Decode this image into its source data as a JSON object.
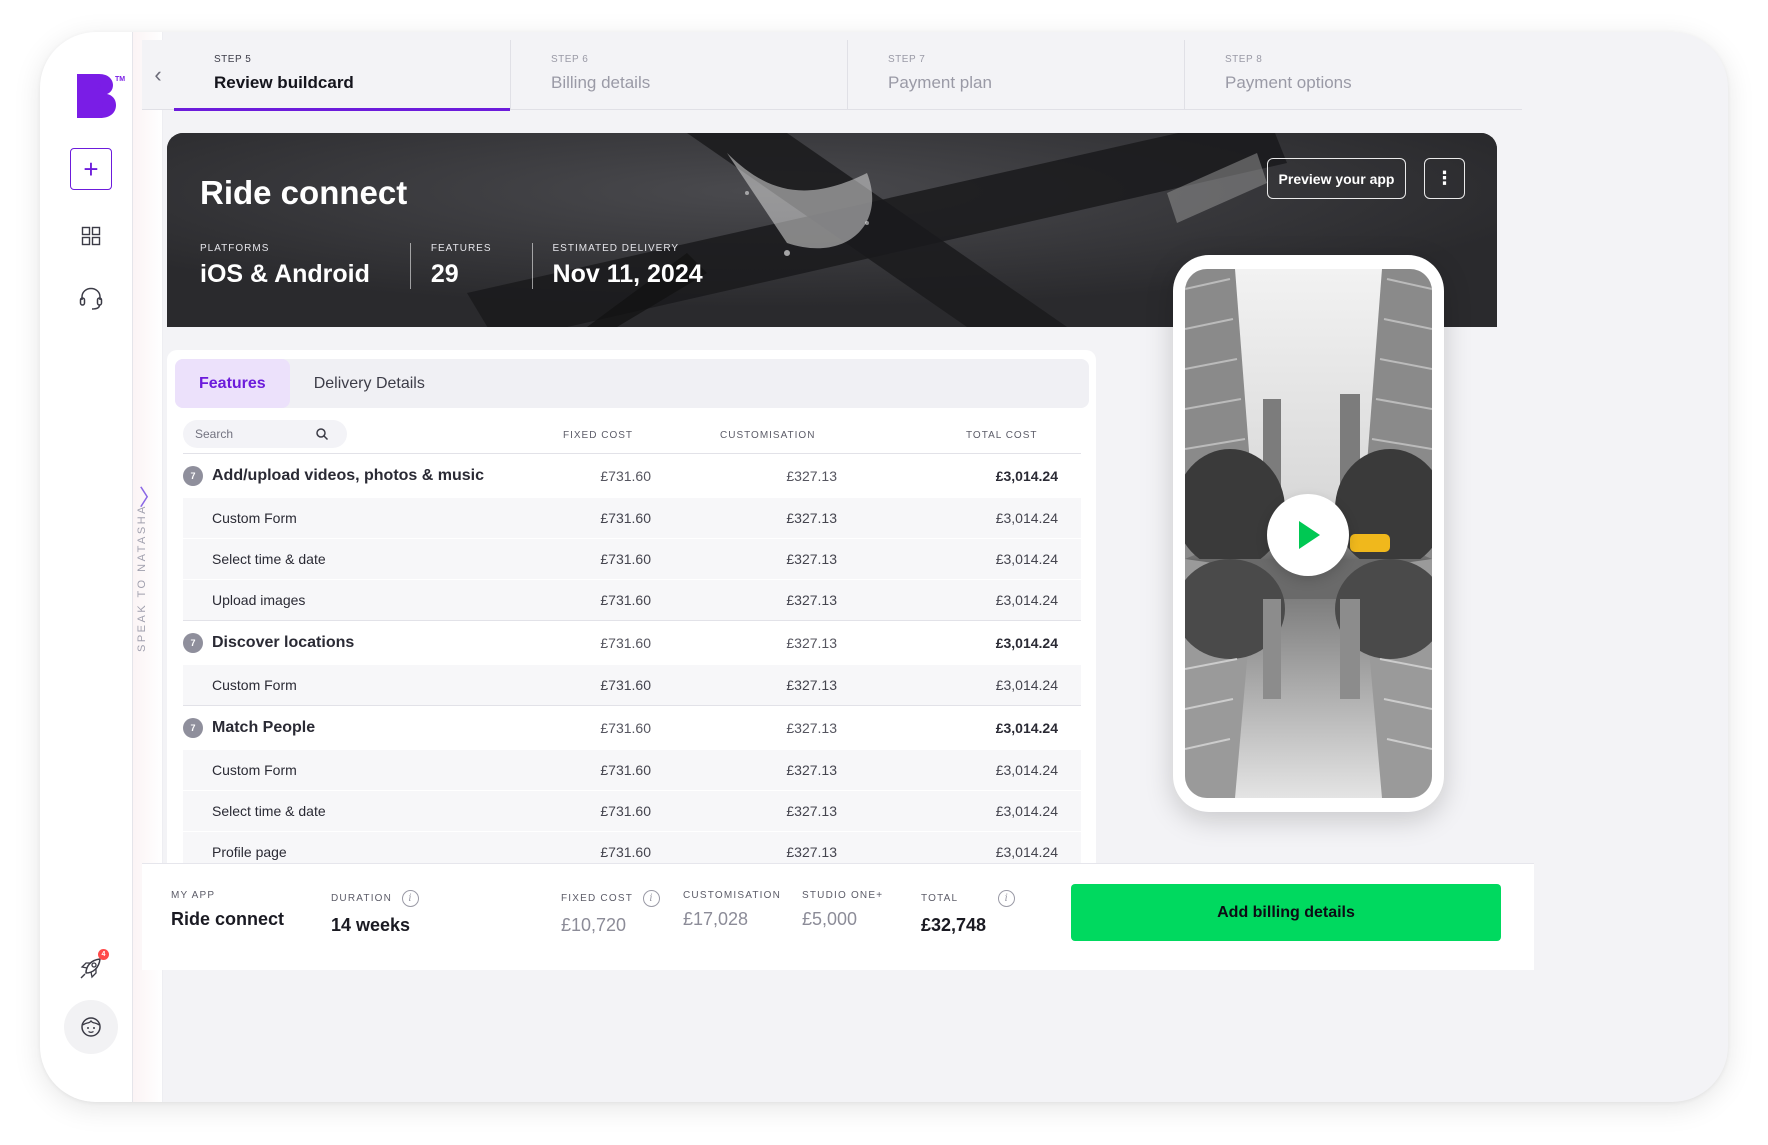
{
  "sidebar": {
    "rocket_badge": "4",
    "icons": [
      "logo-b",
      "plus-icon",
      "dashboard-grid-icon",
      "headset-icon",
      "rocket-icon",
      "avatar-icon"
    ]
  },
  "natasha": {
    "label": "SPEAK TO NATASHA"
  },
  "steps": [
    {
      "num": "STEP 5",
      "title": "Review buildcard",
      "active": true
    },
    {
      "num": "STEP 6",
      "title": "Billing details",
      "active": false
    },
    {
      "num": "STEP 7",
      "title": "Payment plan",
      "active": false
    },
    {
      "num": "STEP 8",
      "title": "Payment options",
      "active": false
    }
  ],
  "hero": {
    "title": "Ride connect",
    "platforms_label": "PLATFORMS",
    "platforms_value": "iOS & Android",
    "features_label": "FEATURES",
    "features_value": "29",
    "delivery_label": "ESTIMATED DELIVERY",
    "delivery_value": "Nov 11, 2024",
    "preview_button": "Preview your app",
    "more_button": "⋮"
  },
  "tabs": {
    "features": "Features",
    "delivery": "Delivery Details"
  },
  "table": {
    "search_placeholder": "Search",
    "headers": {
      "fixed": "FIXED COST",
      "custom": "CUSTOMISATION",
      "total": "TOTAL COST"
    },
    "rows": [
      {
        "type": "group",
        "count": "7",
        "name": "Add/upload videos, photos & music",
        "fixed": "£731.60",
        "cust": "£327.13",
        "total": "£3,014.24"
      },
      {
        "type": "sub",
        "name": "Custom Form",
        "fixed": "£731.60",
        "cust": "£327.13",
        "total": "£3,014.24"
      },
      {
        "type": "sub",
        "name": "Select time & date",
        "fixed": "£731.60",
        "cust": "£327.13",
        "total": "£3,014.24"
      },
      {
        "type": "sub",
        "name": "Upload images",
        "fixed": "£731.60",
        "cust": "£327.13",
        "total": "£3,014.24"
      },
      {
        "type": "group",
        "count": "7",
        "name": "Discover locations",
        "fixed": "£731.60",
        "cust": "£327.13",
        "total": "£3,014.24"
      },
      {
        "type": "sub",
        "name": "Custom Form",
        "fixed": "£731.60",
        "cust": "£327.13",
        "total": "£3,014.24"
      },
      {
        "type": "group",
        "count": "7",
        "name": "Match People",
        "fixed": "£731.60",
        "cust": "£327.13",
        "total": "£3,014.24"
      },
      {
        "type": "sub",
        "name": "Custom Form",
        "fixed": "£731.60",
        "cust": "£327.13",
        "total": "£3,014.24"
      },
      {
        "type": "sub",
        "name": "Select time & date",
        "fixed": "£731.60",
        "cust": "£327.13",
        "total": "£3,014.24"
      },
      {
        "type": "sub",
        "name": "Profile page",
        "fixed": "£731.60",
        "cust": "£327.13",
        "total": "£3,014.24"
      }
    ]
  },
  "footer": {
    "myapp_label": "MY APP",
    "myapp_value": "Ride connect",
    "duration_label": "DURATION",
    "duration_value": "14 weeks",
    "fixed_label": "FIXED COST",
    "fixed_value": "£10,720",
    "custom_label": "CUSTOMISATION",
    "custom_value": "£17,028",
    "studio_label": "STUDIO ONE+",
    "studio_value": "£5,000",
    "total_label": "TOTAL",
    "total_value": "£32,748",
    "billing_button": "Add billing details"
  },
  "colors": {
    "accent": "#6c1bdb",
    "cta": "#00d95f",
    "hero_bg": "#2d2d30"
  }
}
